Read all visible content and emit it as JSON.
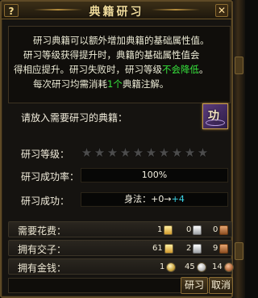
{
  "window": {
    "title": "典籍研习",
    "help_label": "?",
    "close_label": "✕"
  },
  "description": {
    "line1": "研习典籍可以额外增加典籍的基础属性值。",
    "line2_a": "研习等级获得提升时，典籍的基础属性值会",
    "line2_b": "得相应提升。研习失败时，研习等级",
    "line2_highlight": "不会降低",
    "line2_c": "。",
    "line3_a": "每次研习均需消耗",
    "line3_highlight": "1个",
    "line3_b": "典籍注解。"
  },
  "book": {
    "prompt": "请放入需要研习的典籍：",
    "slot_glyph": "功"
  },
  "level": {
    "label": "研习等级：",
    "stars_total": 10,
    "stars_filled": 0
  },
  "success_rate": {
    "label": "研习成功率：",
    "value": "100%"
  },
  "success_result": {
    "label": "研习成功：",
    "attr_name": "身法：",
    "from": "+0",
    "arrow": "→",
    "to": "+4"
  },
  "costs": {
    "required": {
      "label": "需要花费：",
      "gold": "1",
      "silver": "0",
      "copper": "0"
    },
    "owned_ingots": {
      "label": "拥有交子：",
      "gold": "61",
      "silver": "2",
      "copper": "9"
    },
    "owned_money": {
      "label": "拥有金钱：",
      "gold": "1",
      "silver": "45",
      "copper": "14"
    }
  },
  "buttons": {
    "study": "研习",
    "cancel": "取消"
  },
  "colors": {
    "highlight_green": "#36e23c",
    "attr_plus_cyan": "#3cd6e8",
    "star_on": "#e8b73a",
    "star_off": "#4c4c4c",
    "frame_gold": "#8a6c35"
  }
}
